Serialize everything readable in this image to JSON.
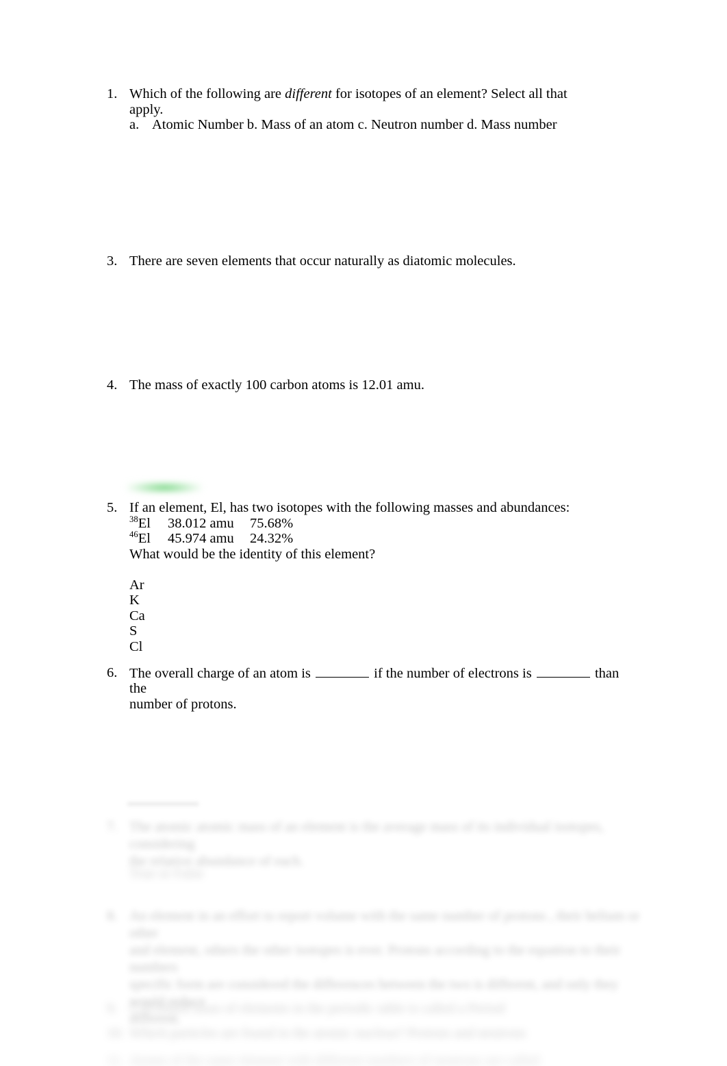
{
  "document": {
    "background_color": "#ffffff",
    "text_color": "#000000",
    "highlight_color": "#4ac85a"
  },
  "questions": [
    {
      "number": "1.",
      "text_before_italic": "Which of the following are ",
      "italic_word": "different",
      "text_after_italic": " for isotopes of an element? Select all that apply.",
      "sub_label": "a.",
      "sub_text": "Atomic Number b. Mass of an atom c. Neutron number d. Mass number"
    },
    {
      "number": "3.",
      "text": "There are seven elements that occur naturally as diatomic molecules."
    },
    {
      "number": "4.",
      "text": "The mass of exactly 100 carbon atoms is 12.01 amu."
    },
    {
      "number": "5.",
      "stem": "If an element, El, has two isotopes with the following masses and abundances:",
      "isotopes": [
        {
          "mass_number": "38",
          "symbol": "El",
          "mass": "38.012 amu",
          "abundance": "75.68%"
        },
        {
          "mass_number": "46",
          "symbol": "El",
          "mass": "45.974 amu",
          "abundance": "24.32%"
        }
      ],
      "prompt": "What would be the identity of this element?",
      "choices": [
        "Ar",
        "K",
        "Ca",
        "S",
        "Cl"
      ]
    },
    {
      "number": "6.",
      "part_1": "The overall charge of an atom is ",
      "part_2": " if the number of electrons is ",
      "part_3": " than the",
      "line_2": "number of protons."
    }
  ],
  "obscured_items": [
    {
      "number": "7.",
      "lines": [
        "The atomic atomic mass of an element is the average mass of its individual isotopes, considering",
        "the relative abundance of each."
      ],
      "extra_line": "True or False"
    },
    {
      "number": "8.",
      "lines": [
        "An element in an effort to report volume with the same number of protons , their helium or other",
        "and element, others the other isotopes is ever. Protons according to the equation to their numbers",
        "specific form are considered the differences between the two is different, and only they would reduce",
        "different."
      ]
    },
    {
      "number": "9.",
      "lines": [
        "Calculated mass of elements in the periodic table is called a Period"
      ]
    },
    {
      "number": "10.",
      "lines": [
        "Which particles are found in the atomic nucleus? Protons and neutrons"
      ]
    },
    {
      "number": "11.",
      "lines": [
        "Atoms of the same element with different numbers of neutrons are called"
      ]
    }
  ]
}
